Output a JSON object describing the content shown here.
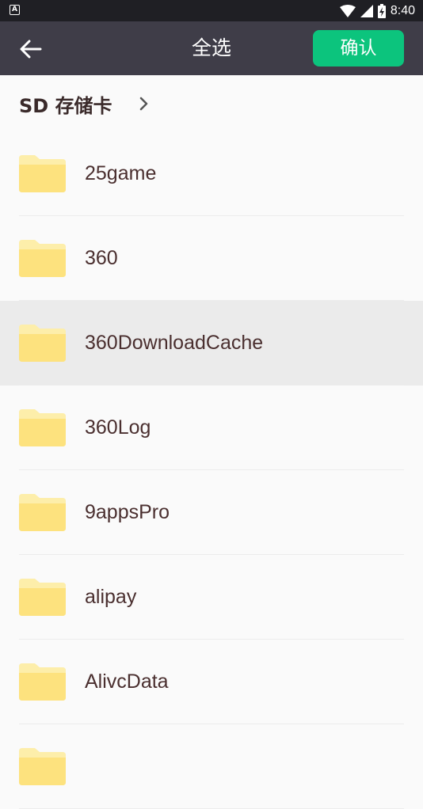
{
  "status_bar": {
    "time": "8:40",
    "left_icon": "app-notification-icon"
  },
  "toolbar": {
    "back_icon": "arrow-left-icon",
    "title": "全选",
    "confirm_label": "确认"
  },
  "breadcrumb": {
    "label": "SD 存储卡"
  },
  "colors": {
    "toolbar": "#3f3d48",
    "confirm": "#0cc47d",
    "folder": "#fde27e",
    "folder_tab": "#fdeeaa",
    "text": "#4a2f2f"
  },
  "folders": [
    {
      "name": "25game",
      "selected": false
    },
    {
      "name": "360",
      "selected": false
    },
    {
      "name": "360DownloadCache",
      "selected": true
    },
    {
      "name": "360Log",
      "selected": false
    },
    {
      "name": "9appsPro",
      "selected": false
    },
    {
      "name": "alipay",
      "selected": false
    },
    {
      "name": "AlivcData",
      "selected": false
    },
    {
      "name": "",
      "selected": false
    }
  ]
}
